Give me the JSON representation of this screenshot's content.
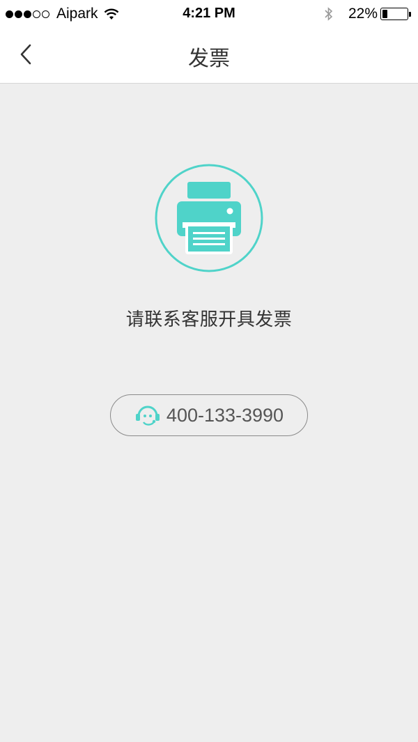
{
  "status_bar": {
    "carrier": "Aipark",
    "time": "4:21 PM",
    "battery_percent": "22%",
    "battery_level": 0.22,
    "signal_bars_filled": 3,
    "signal_bars_total": 5
  },
  "nav": {
    "title": "发票"
  },
  "main": {
    "message": "请联系客服开具发票",
    "phone_number": "400-133-3990"
  },
  "colors": {
    "accent": "#4fd3c9",
    "background": "#eeeeee",
    "text": "#333333"
  },
  "icons": {
    "back": "chevron-left-icon",
    "printer": "printer-icon",
    "phone": "customer-service-icon"
  }
}
